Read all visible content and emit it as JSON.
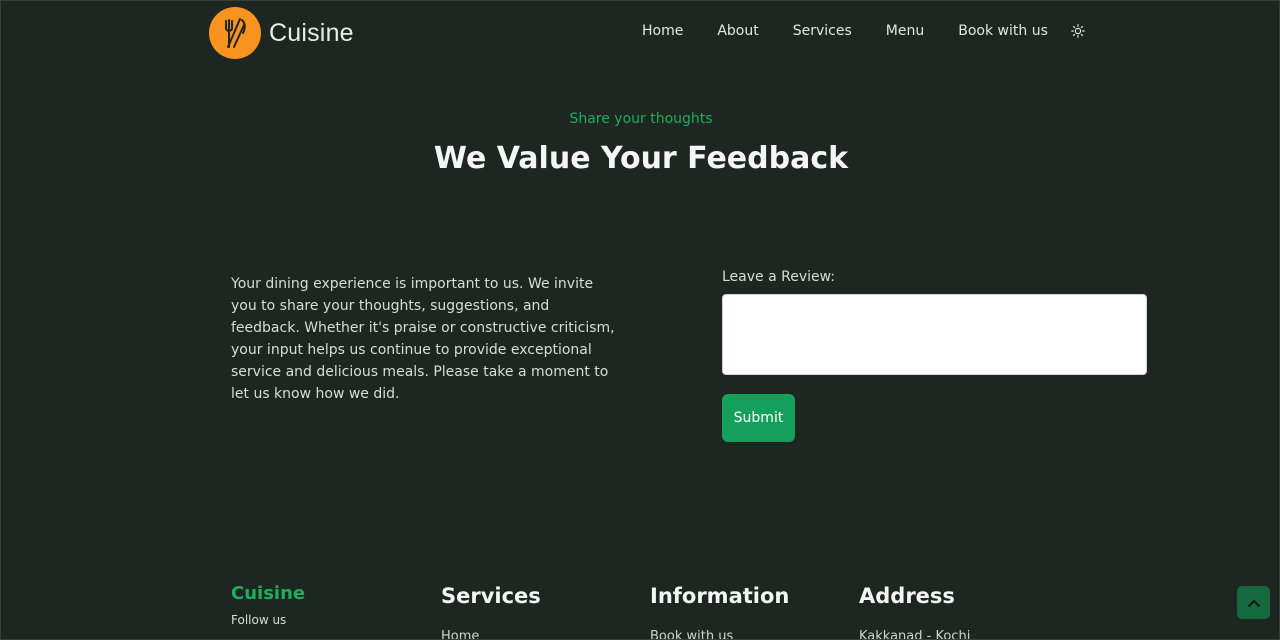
{
  "brand": {
    "name": "Cuisine"
  },
  "nav": {
    "items": [
      "Home",
      "About",
      "Services",
      "Menu",
      "Book with us"
    ],
    "theme_toggle_icon": "sun-icon"
  },
  "section": {
    "eyebrow": "Share your thoughts",
    "title": "We Value Your Feedback",
    "intro": "Your dining experience is important to us. We invite you to share your thoughts, suggestions, and feedback. Whether it's praise or constructive criticism, your input helps us continue to provide exceptional service and delicious meals. Please take a moment to let us know how we did."
  },
  "form": {
    "label": "Leave a Review:",
    "value": "",
    "submit_label": "Submit"
  },
  "footer": {
    "brand": "Cuisine",
    "follow": "Follow us",
    "columns": [
      {
        "title": "Services",
        "first_link": "Home"
      },
      {
        "title": "Information",
        "first_link": "Book with us"
      },
      {
        "title": "Address",
        "first_link": "Kakkanad - Kochi"
      }
    ]
  },
  "colors": {
    "background": "#1e2622",
    "accent": "#14a05a",
    "logo": "#f7931e"
  },
  "icons": {
    "back_to_top": "chevron-up-icon",
    "logo": "fork-knife-icon"
  }
}
